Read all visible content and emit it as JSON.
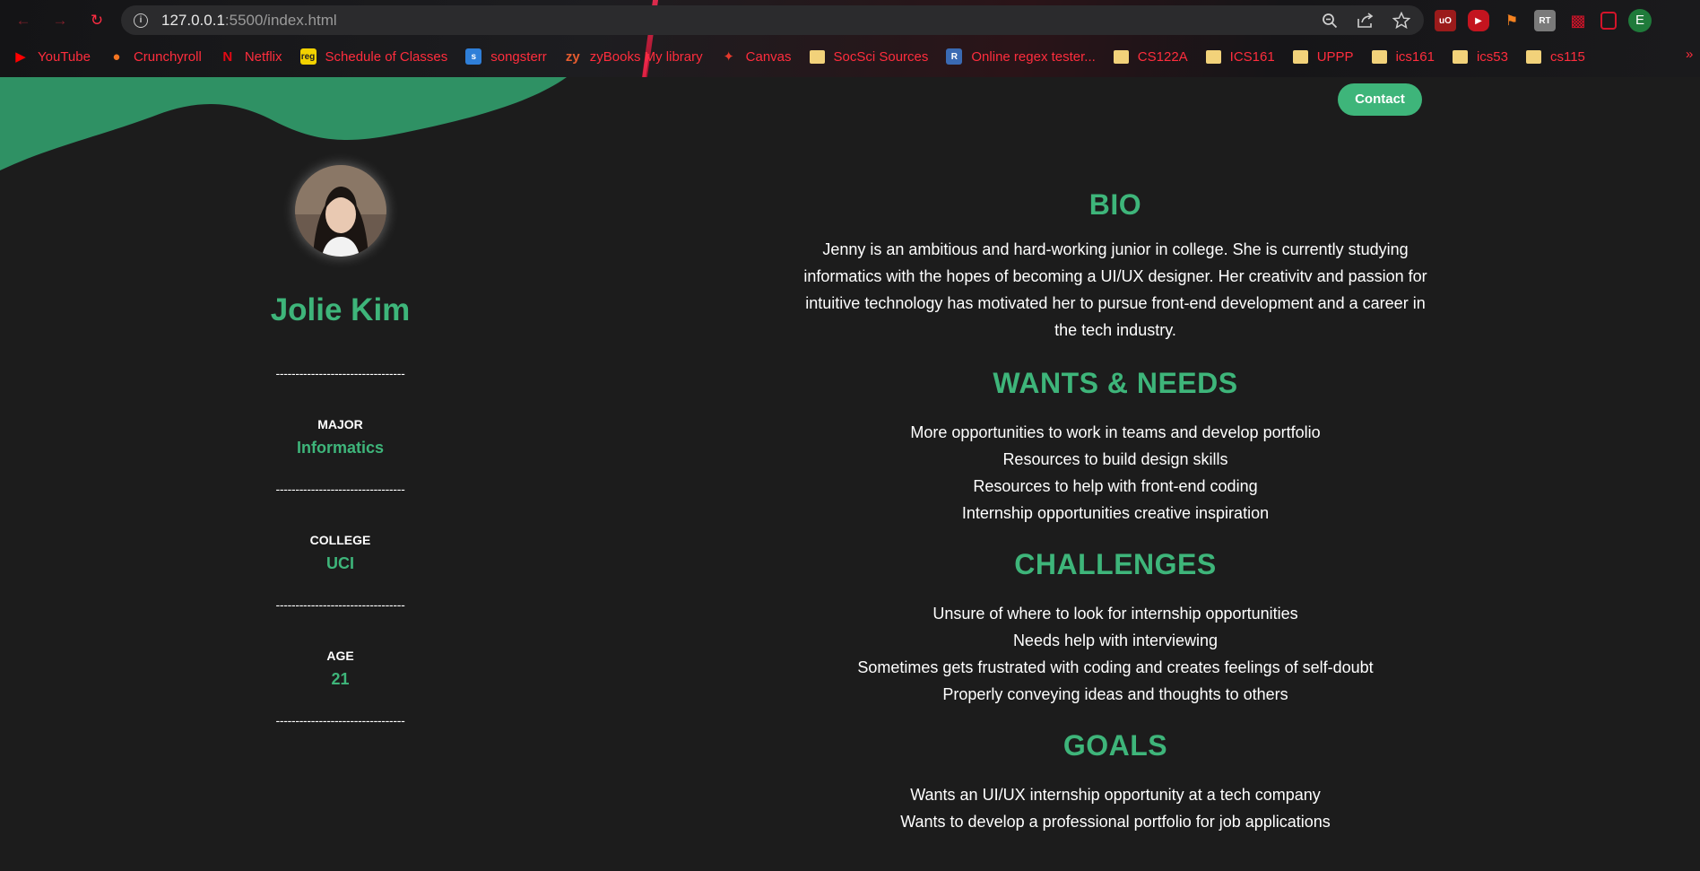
{
  "browser": {
    "url_host": "127.0.0.1",
    "url_path": ":5500/index.html",
    "profile_initial": "E",
    "bookmarks": [
      {
        "label": "YouTube",
        "icon": "youtube-icon",
        "color": "#ff0000"
      },
      {
        "label": "Crunchyroll",
        "icon": "crunchyroll-icon",
        "color": "#f47521"
      },
      {
        "label": "Netflix",
        "icon": "netflix-icon",
        "color": "#e50914"
      },
      {
        "label": "Schedule of Classes",
        "icon": "reg-icon",
        "color": "#f2d200"
      },
      {
        "label": "songsterr",
        "icon": "songsterr-icon",
        "color": "#2f7fd8"
      },
      {
        "label": "zyBooks My library",
        "icon": "zybooks-icon",
        "color": "#e65c2f"
      },
      {
        "label": "Canvas",
        "icon": "canvas-icon",
        "color": "#e4392c"
      },
      {
        "label": "SocSci Sources",
        "icon": "folder-icon",
        "color": "#f2d27a"
      },
      {
        "label": "Online regex tester...",
        "icon": "regex-icon",
        "color": "#3a6ab3"
      },
      {
        "label": "CS122A",
        "icon": "folder-icon",
        "color": "#f2d27a"
      },
      {
        "label": "ICS161",
        "icon": "folder-icon",
        "color": "#f2d27a"
      },
      {
        "label": "UPPP",
        "icon": "folder-icon",
        "color": "#f2d27a"
      },
      {
        "label": "ics161",
        "icon": "folder-icon",
        "color": "#f2d27a"
      },
      {
        "label": "ics53",
        "icon": "folder-icon",
        "color": "#f2d27a"
      },
      {
        "label": "cs115",
        "icon": "folder-icon",
        "color": "#f2d27a"
      }
    ],
    "bookmarks_more": "»"
  },
  "colors": {
    "accent": "#3eb57a",
    "wave": "#2f9164",
    "background": "#1c1c1c"
  },
  "header": {
    "contact_label": "Contact"
  },
  "profile": {
    "name": "Jolie Kim",
    "divider": "---------------------------------",
    "facts": [
      {
        "key": "MAJOR",
        "value": "Informatics"
      },
      {
        "key": "COLLEGE",
        "value": "UCI"
      },
      {
        "key": "AGE",
        "value": "21"
      }
    ]
  },
  "sections": {
    "bio": {
      "title": "BIO",
      "text": "Jenny is an ambitious and hard-working junior in college. She is currently studying informatics with the hopes of becoming a UI/UX designer. Her creativitv and passion for intuitive technology has motivated her to pursue front-end development and a career in the tech industry."
    },
    "wants": {
      "title": "WANTS & NEEDS",
      "items": [
        "More opportunities to work in teams and develop portfolio",
        "Resources to build design skills",
        "Resources to help with front-end coding",
        "Internship opportunities creative inspiration"
      ]
    },
    "challenges": {
      "title": "CHALLENGES",
      "items": [
        "Unsure of where to look for internship opportunities",
        "Needs help with interviewing",
        "Sometimes gets frustrated with coding and creates feelings of self-doubt",
        "Properly conveying ideas and thoughts to others"
      ]
    },
    "goals": {
      "title": "GOALS",
      "items": [
        "Wants an UI/UX internship opportunity at a tech company",
        "Wants to develop a professional portfolio for job applications"
      ]
    }
  }
}
